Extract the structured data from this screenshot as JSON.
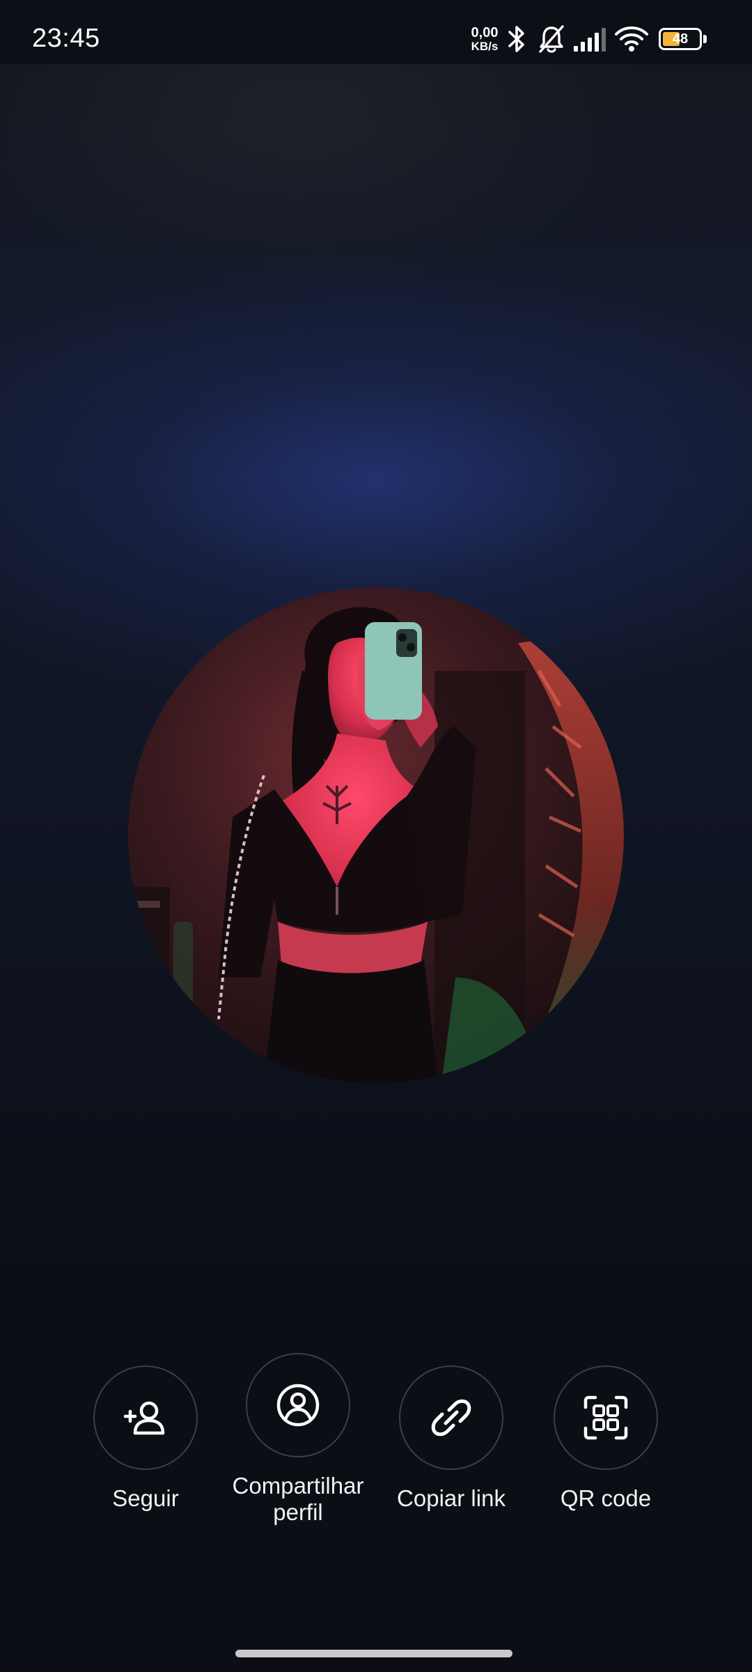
{
  "status_bar": {
    "time": "23:45",
    "net_speed_value": "0,00",
    "net_speed_unit": "KB/s",
    "battery_level": "48",
    "battery_percent": 48,
    "icons": [
      "bluetooth-icon",
      "bell-muted-icon",
      "signal-icon",
      "wifi-icon",
      "battery-icon"
    ]
  },
  "profile": {
    "photo": "profile-photo"
  },
  "actions": [
    {
      "label": "Seguir",
      "icon": "add-person-icon"
    },
    {
      "label": "Compartilhar perfil",
      "icon": "profile-circle-icon"
    },
    {
      "label": "Copiar link",
      "icon": "link-icon"
    },
    {
      "label": "QR code",
      "icon": "qr-scan-icon"
    }
  ],
  "colors": {
    "background": "#0b0e14",
    "accent_glow": "#263880",
    "battery": "#f2b53a",
    "button_border": "#3a3f48"
  }
}
